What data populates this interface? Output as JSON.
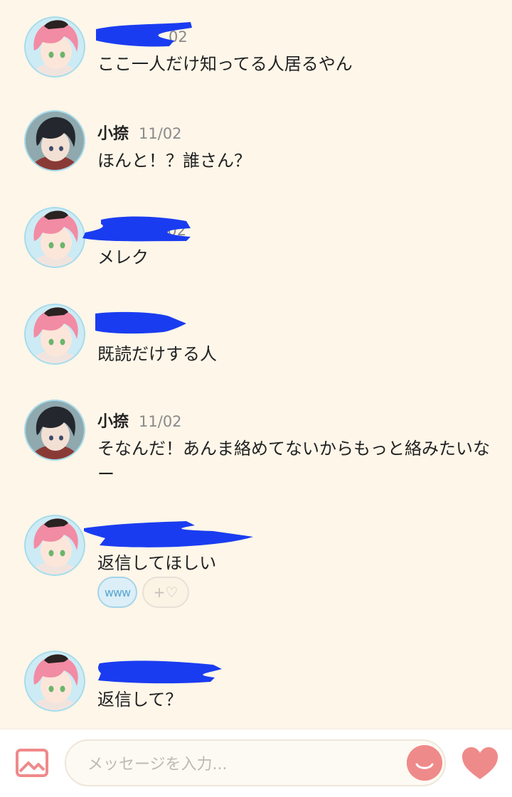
{
  "colors": {
    "background": "#fdf6e9",
    "redaction": "#1a3cf0",
    "accent": "#ef8a8a"
  },
  "messages": [
    {
      "sender": "",
      "time": "02",
      "text": "ここ一人だけ知ってる人居るやん",
      "avatar": "pink-hair-avatar",
      "sender_redacted": true
    },
    {
      "sender": "小捺",
      "time": "11/02",
      "text": "ほんと！？誰さん？",
      "avatar": "dark-hair-avatar",
      "sender_redacted": false
    },
    {
      "sender": "",
      "time": "1/02",
      "text": "メレク",
      "avatar": "pink-hair-avatar",
      "sender_redacted": true
    },
    {
      "sender": "",
      "time": "",
      "text": "既読だけする人",
      "avatar": "pink-hair-avatar",
      "sender_redacted": true
    },
    {
      "sender": "小捺",
      "time": "11/02",
      "text": "そなんだ！あんま絡めてないからもっと絡みたいなー",
      "avatar": "dark-hair-avatar",
      "sender_redacted": false
    },
    {
      "sender": "",
      "time": "",
      "text": "返信してほしい",
      "avatar": "pink-hair-avatar",
      "sender_redacted": true,
      "reactions": {
        "stamp": "www",
        "add": "+♡"
      }
    },
    {
      "sender": "",
      "time": "",
      "text": "返信して？",
      "avatar": "pink-hair-avatar",
      "sender_redacted": true
    }
  ],
  "composer": {
    "placeholder": "メッセージを入力...",
    "icons": [
      "image-icon",
      "emoji-face-icon",
      "heart-icon"
    ]
  }
}
